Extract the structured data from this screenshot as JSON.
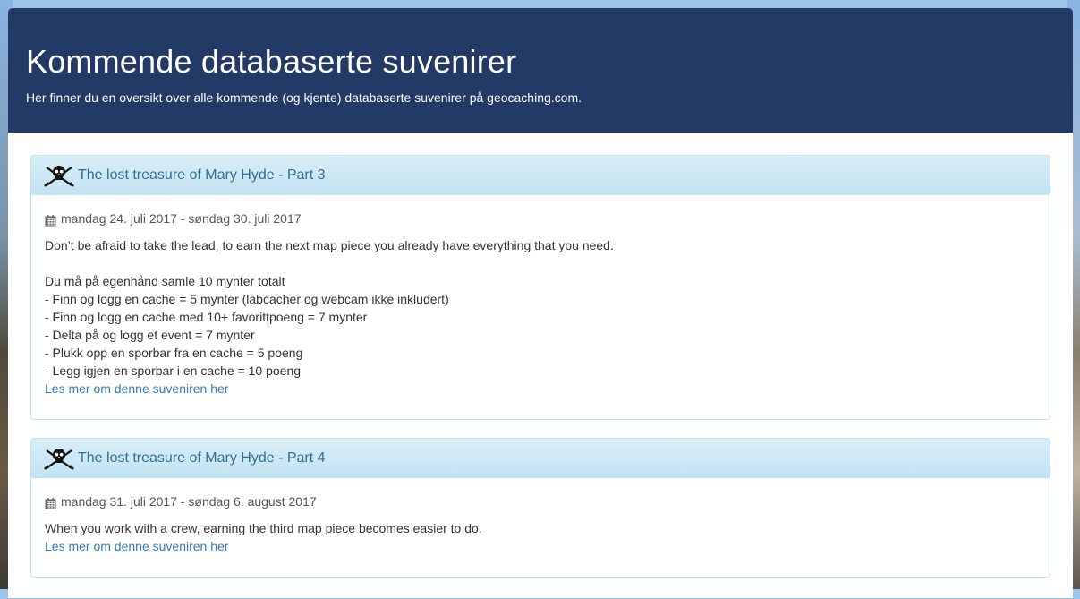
{
  "header": {
    "title": "Kommende databaserte suvenirer",
    "subtitle": "Her finner du en oversikt over alle kommende (og kjente) databaserte suvenirer på geocaching.com."
  },
  "souvenirs": [
    {
      "icon": "pirate-skull-icon",
      "title": "The lost treasure of Mary Hyde - Part 3",
      "date": "mandag 24. juli 2017 - søndag 30. juli 2017",
      "intro": "Don’t be afraid to take the lead, to earn the next map piece you already have everything that you need.",
      "lines": [
        "Du må på egenhånd samle 10 mynter totalt",
        "- Finn og logg en cache = 5 mynter (labcacher og webcam ikke inkludert)",
        "- Finn og logg en cache med 10+ favorittpoeng = 7 mynter",
        "- Delta på og logg et event = 7 mynter",
        "- Plukk opp en sporbar fra en cache = 5 poeng",
        "- Legg igjen en sporbar i en cache = 10 poeng"
      ],
      "link": "Les mer om denne suveniren her"
    },
    {
      "icon": "pirate-skull-icon",
      "title": "The lost treasure of Mary Hyde - Part 4",
      "date": "mandag 31. juli 2017 - søndag 6. august 2017",
      "intro": "When you work with a crew, earning the third map piece becomes easier to do.",
      "link": "Les mer om denne suveniren her"
    }
  ],
  "colors": {
    "header_bg": "#243a66",
    "panel_heading": "#d9edf7",
    "panel_border": "#bce8f1",
    "panel_title": "#31708f",
    "link": "#337ab7"
  }
}
